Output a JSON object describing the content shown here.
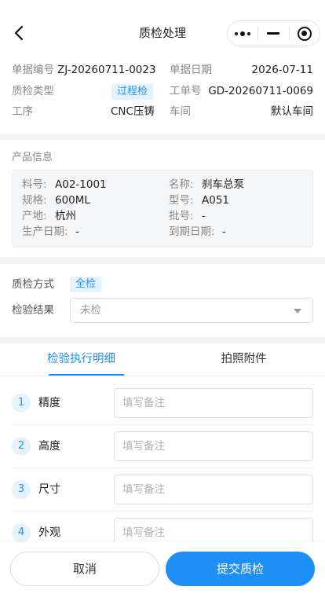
{
  "nav": {
    "title": "质检处理"
  },
  "header": {
    "doc_no_label": "单据编号",
    "doc_no": "ZJ-20260711-0023",
    "doc_date_label": "单据日期",
    "doc_date": "2026-07-11",
    "qc_type_label": "质检类型",
    "qc_type": "过程检",
    "work_order_label": "工单号",
    "work_order": "GD-20260711-0069",
    "process_label": "工序",
    "process": "CNC压铸",
    "workshop_label": "车间",
    "workshop": "默认车间"
  },
  "product": {
    "section_title": "产品信息",
    "material_label": "料号:",
    "material": "A02-1001",
    "name_label": "名称:",
    "name": "刹车总泵",
    "spec_label": "规格:",
    "spec": "600ML",
    "model_label": "型号:",
    "model": "A051",
    "origin_label": "产地:",
    "origin": "杭州",
    "batch_label": "批号:",
    "batch": "-",
    "mfg_date_label": "生产日期:",
    "mfg_date": "-",
    "exp_date_label": "到期日期:",
    "exp_date": "-"
  },
  "inspection": {
    "method_label": "质检方式",
    "method": "全检",
    "result_label": "检验结果",
    "result_selected": "未检"
  },
  "tabs": [
    {
      "label": "检验执行明细",
      "active": true
    },
    {
      "label": "拍照附件",
      "active": false
    }
  ],
  "items": [
    {
      "no": "1",
      "name": "精度",
      "note_placeholder": "填写备注"
    },
    {
      "no": "2",
      "name": "高度",
      "note_placeholder": "填写备注"
    },
    {
      "no": "3",
      "name": "尺寸",
      "note_placeholder": "填写备注"
    },
    {
      "no": "4",
      "name": "外观",
      "note_placeholder": "填写备注"
    }
  ],
  "actions": {
    "cancel": "取消",
    "submit": "提交质检"
  },
  "colors": {
    "accent": "#1e90f5",
    "tag_bg": "#e3f2fd"
  }
}
